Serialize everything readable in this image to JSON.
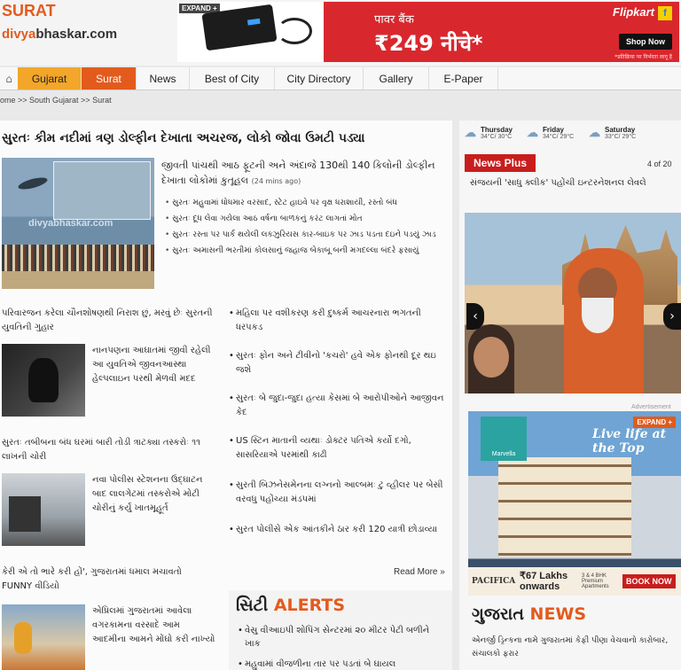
{
  "header": {
    "city": "SURAT",
    "site_prefix": "divya",
    "site_suffix": "bhaskar.com"
  },
  "banner": {
    "expand_label": "EXPAND +",
    "hindi_text": "पावर बैंक",
    "price_text": "₹249 नीचे*",
    "brand": "Flipkart",
    "cta": "Shop Now",
    "fine_print": "*प्रतिक्रिया पर निर्भरता लागू है"
  },
  "nav": {
    "items": [
      "Gujarat",
      "Surat",
      "News",
      "Best of City",
      "City Directory",
      "Gallery",
      "E-Paper"
    ]
  },
  "breadcrumb": "ome >> South Gujarat >> Surat",
  "lead": {
    "title": "સુરતઃ કીમ નદીમાં ત્રણ ડોલ્ફીન દેખાતા અચરજ, લોકો જોવા ઉમટી પડ્યા",
    "summary": "જીવતી પાંચથી આઠ ફૂટની અને અંદાજે 130થી 140 કિલોની ડોલ્ફીન દેખાતા લોકોમાં કુતૂહલ",
    "time": "(24 mins ago)",
    "watermark": "divyabhaskar.com",
    "bullets": [
      "સુરતઃ મહુવામાં ધોધમાર વરસાદ, સ્ટેટ હાઇવે પર વૃક્ષ ધરાશાયી, રસ્તો બંધ",
      "સુરતઃ દૂધ લેવા ગયેલા આઠ વર્ષના બાળકનું કરંટ લાગતાં મોત",
      "સુરતઃ રસ્તા પર પાર્ક થયેલી લક્ઝુરિયસ કાર-બાઇક પર ઝાડ પડતા દઇને પડયું ઝાડ",
      "સુરતઃ અમાસની ભરતીમાં કોલસાનું જહાજ બેકાબૂ બની મગદલ્લા બંદરે ફસાયું"
    ]
  },
  "left_stories": {
    "s1_head": "પરિવારજન કરેલા ચૌનશોષણથી નિરાશ છું, મરવું છેઃ સુરતની યુવતિની ગુહાર",
    "s1_body": "નાનપણના આઘાતમાં જીવી રહેલી આ યુવતિએ જીવનઆસ્થા હેલ્પલાઇન પરથી મેળવી મદદ",
    "s2_head": "સુરતઃ તબીબના બંધ ઘરમાં બારી તોડી ત્રાટક્યા તસ્કરોઃ ૧૧ લાખની ચોરી",
    "s2_body": "નવા પોલીસ સ્ટેશનના ઉદ્ઘાટન બાદ લાલગેટમાં તસ્કરોએ મોટી ચોરીનું કર્યું ખાતમૂહૂર્ત",
    "s3_head": "કેરી એ તો ભારે કરી હોં', ગુજરાતમાં ધમાલ મચાવતો FUNNY વીડિયો",
    "s3_body": "એપ્રિલમાં ગુજરાતમાં આવેલા વગરકામના વરસાદે આમ આદમીના આમને મોંઘો કરી નાખ્યો"
  },
  "right_list": [
    "મહિલા પર વશીકરણ કરી દુષ્કર્મ આચરનારા ભગતની ધરપકડ",
    "સુરતઃ ફોન અને ટીવીનો 'કચરો' હવે એક ફોનથી દૂર થઇ જશે",
    "સુરતઃ બે જુદા-જુદા હત્યા કેસમાં બે આરોપીઓને આજીવન કેદ",
    "US સ્ટિન માતાની વ્યથાઃ ડોક્ટર પતિએ કર્યો દગો, સાસરિયાએ પરમાંથી કાઢી",
    "સુરતી બિઝનેસમેનના લગ્નનો આલ્બમઃ ટુ વ્હીલર પર બેસી વરવધુ પહોંચ્યા મંડપમાં",
    "સુરત પોલીસે એક આંતકીને ઠાર કરી 120 યાત્રી છોડાવ્યા"
  ],
  "read_more": "Read More »",
  "city_alerts": {
    "title_gu": "સિટી",
    "title_en": "ALERTS",
    "items": [
      "વેસુ વીઆઇપી શોપિંગ સેન્ટરમાં ૨૦ મીટર પેટી બળીને ખાક",
      "મહુવામાં વીજળીના તાર પર પડતાં બે ઘાયલ"
    ]
  },
  "weather": [
    {
      "day": "Thursday",
      "temp": "34°C/ 30°C"
    },
    {
      "day": "Friday",
      "temp": "34°C/ 29°C"
    },
    {
      "day": "Saturday",
      "temp": "33°C/ 29°C"
    }
  ],
  "news_plus": {
    "label": "News Plus",
    "count": "4 of 20",
    "title": "સંજયની 'સાધુ ક્લીક' પહોંચી ઇન્ટરનેશનલ લેવલે"
  },
  "ad2": {
    "advert_label": "Advertisement",
    "expand_label": "EXPAND +",
    "brand": "Marvella",
    "tagline": "Live life at the Top",
    "developer": "PACIFICA",
    "price": "₹67 Lakhs onwards",
    "spec": "3 & 4 BHK Premium Apartments",
    "cta": "BOOK NOW"
  },
  "gujarat_news": {
    "title_gu": "ગુજરાત",
    "title_en": "NEWS",
    "text": "એનર્જી ડ્રિન્કના નામે ગુજરાતમાં કેફી પીણા વેચવાનો કારોબાર, સંચાલકો ફરાર"
  }
}
